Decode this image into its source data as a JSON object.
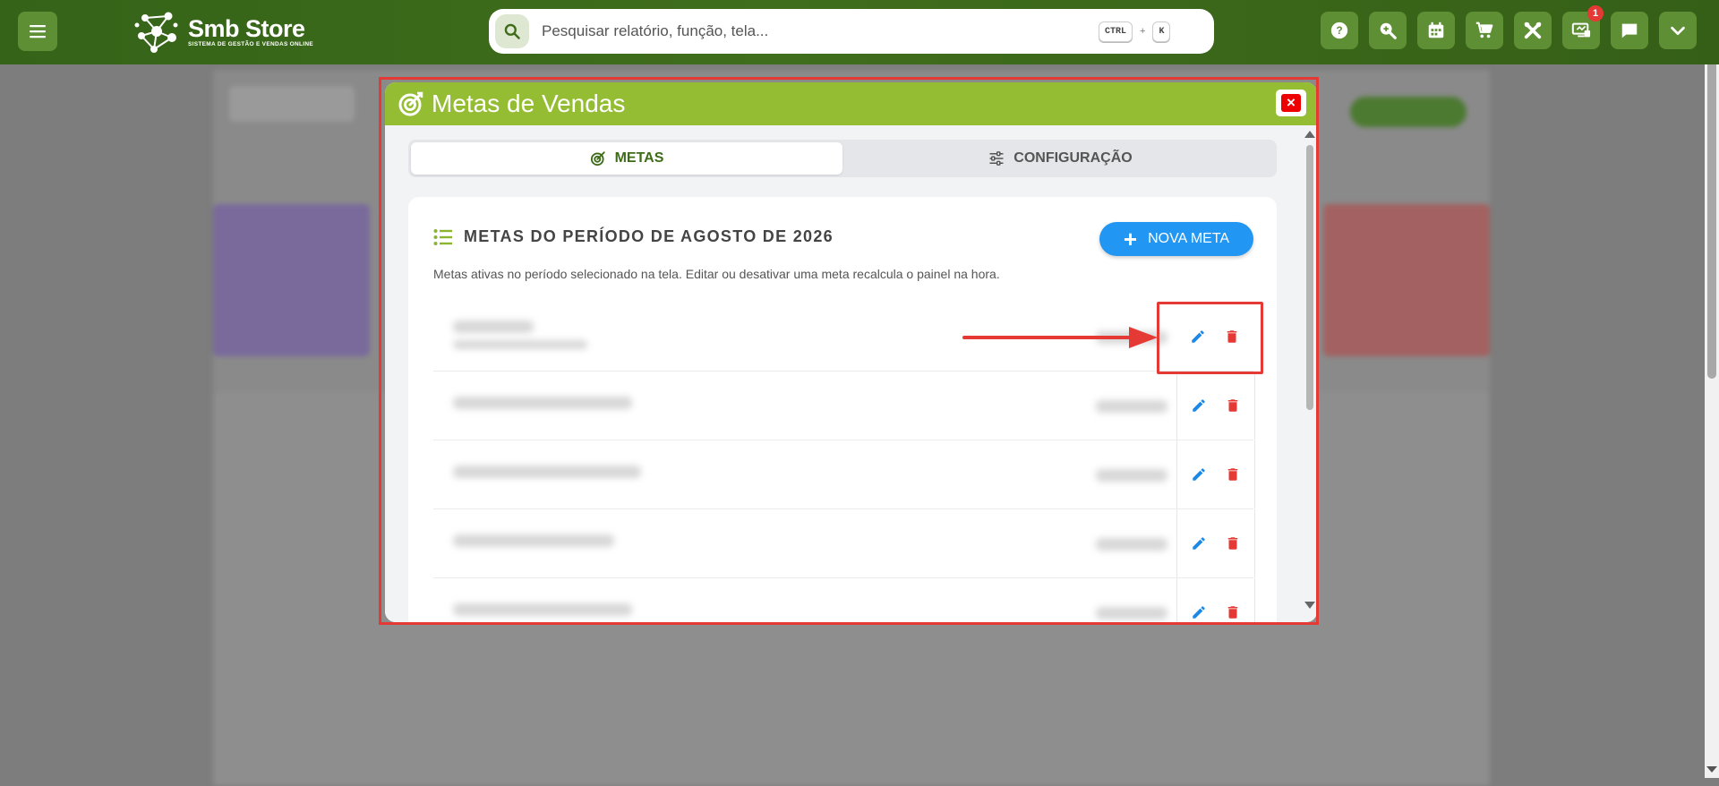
{
  "topbar": {
    "logo_name": "Smb Store",
    "logo_tagline": "SISTEMA DE GESTÃO E VENDAS ONLINE",
    "search_placeholder": "Pesquisar relatório, função, tela...",
    "shortcut_key_1": "CTRL",
    "shortcut_plus": "+",
    "shortcut_key_2": "K",
    "icons": [
      "help-icon",
      "zoom-search-icon",
      "calendar-icon",
      "cart-icon",
      "tools-icon",
      "monitor-icon",
      "chat-icon",
      "chevron-down-icon"
    ],
    "notification_count": "1"
  },
  "modal": {
    "title": "Metas de Vendas",
    "close_label": "×",
    "tabs": [
      {
        "label": "METAS",
        "active": true
      },
      {
        "label": "CONFIGURAÇÃO",
        "active": false
      }
    ],
    "card": {
      "title": "METAS DO PERÍODO DE AGOSTO DE 2026",
      "new_button_label": "NOVA META",
      "description": "Metas ativas no período selecionado na tela. Editar ou desativar uma meta recalcula o painel na hora."
    },
    "rows": 5
  },
  "colors": {
    "topbar": "#3f6e1c",
    "modal_header": "#95bd34",
    "primary_button": "#2196f3",
    "edit_icon": "#1e88e5",
    "delete_icon": "#e53935",
    "highlight": "#e53935"
  }
}
